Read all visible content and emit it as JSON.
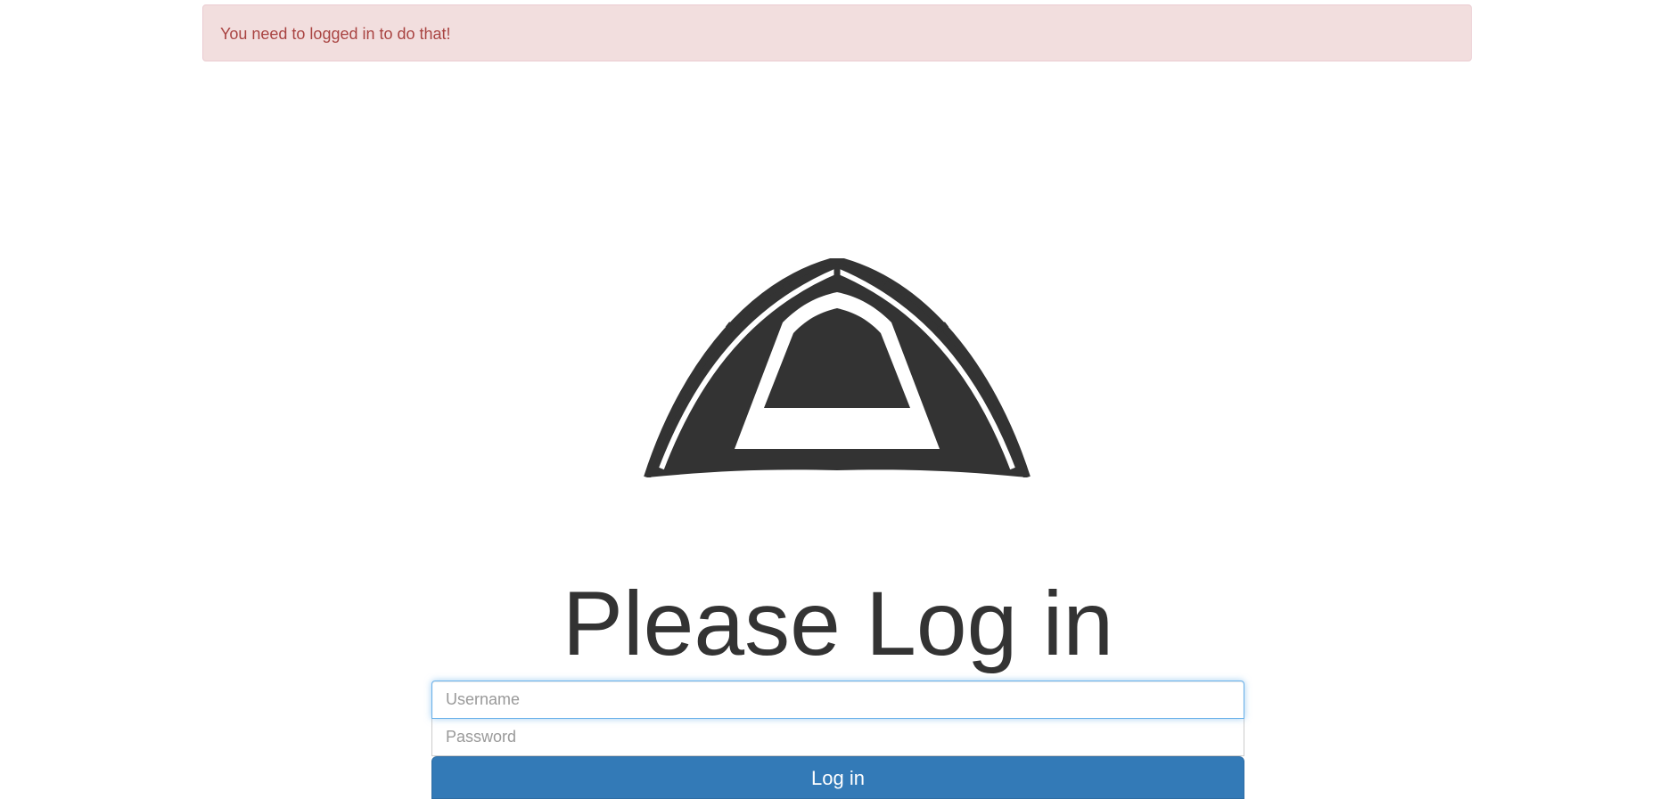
{
  "alert": {
    "message": "You need to logged in to do that!"
  },
  "logo": {
    "icon": "tent-icon",
    "color": "#333333"
  },
  "heading": "Please Log in",
  "form": {
    "username_placeholder": "Username",
    "password_placeholder": "Password",
    "submit_label": "Log in"
  },
  "colors": {
    "alert_background": "#f2dede",
    "alert_text": "#a94442",
    "primary_button": "#337ab7",
    "focus_border": "#66afe9"
  }
}
